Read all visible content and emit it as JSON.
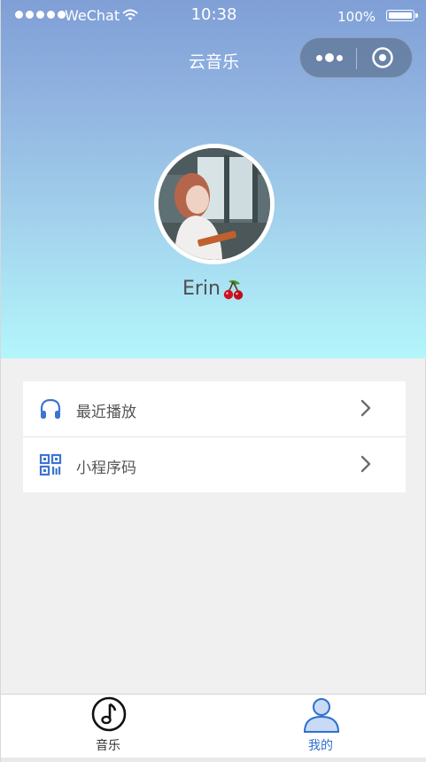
{
  "status_bar": {
    "carrier": "WeChat",
    "time": "10:38",
    "battery": "100%"
  },
  "nav": {
    "title": "云音乐"
  },
  "profile": {
    "username": "Erin"
  },
  "menu": [
    {
      "label": "最近播放",
      "icon": "headphones-icon"
    },
    {
      "label": "小程序码",
      "icon": "qr-code-icon"
    }
  ],
  "tabbar": {
    "tabs": [
      {
        "label": "音乐",
        "icon": "music-note-icon",
        "active": false
      },
      {
        "label": "我的",
        "icon": "user-icon",
        "active": true
      }
    ]
  },
  "colors": {
    "accent": "#2f6fd0",
    "tab_active": "#2f6fd0",
    "tab_inactive": "#333333",
    "hero_top": "#7f9fd6",
    "hero_bottom": "#b3f6fb"
  }
}
